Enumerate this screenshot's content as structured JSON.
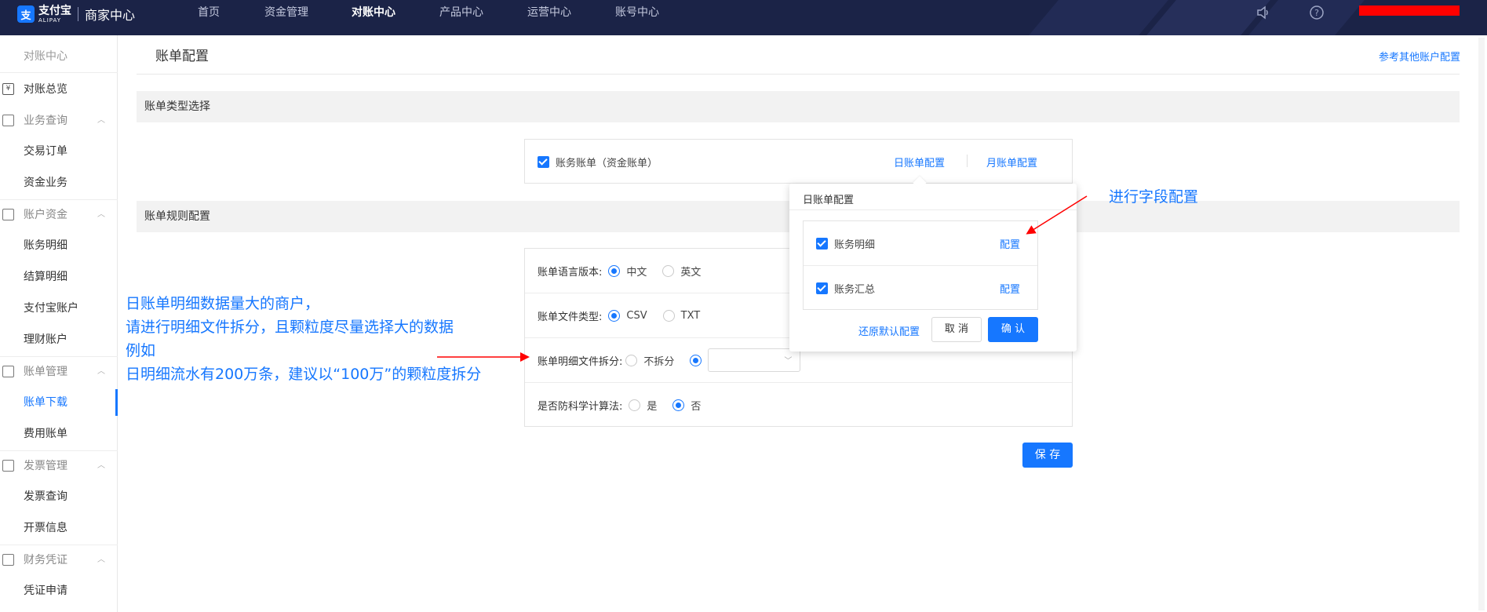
{
  "brand": {
    "logo_glyph": "支",
    "logo_cn": "支付宝",
    "logo_en": "ALIPAY",
    "title": "商家中心"
  },
  "topnav": [
    {
      "label": "首页",
      "active": false
    },
    {
      "label": "资金管理",
      "active": false
    },
    {
      "label": "对账中心",
      "active": true
    },
    {
      "label": "产品中心",
      "active": false
    },
    {
      "label": "运营中心",
      "active": false
    },
    {
      "label": "账号中心",
      "active": false
    }
  ],
  "top_icons": [
    "speaker-icon",
    "help-icon"
  ],
  "sidebar": {
    "title": "对账中心",
    "overview": "对账总览",
    "groups": [
      {
        "label": "业务查询",
        "items": [
          "交易订单",
          "资金业务"
        ]
      },
      {
        "label": "账户资金",
        "items": [
          "账务明细",
          "结算明细",
          "支付宝账户",
          "理财账户"
        ]
      },
      {
        "label": "账单管理",
        "items": [
          "账单下载",
          "费用账单"
        ]
      },
      {
        "label": "发票管理",
        "items": [
          "发票查询",
          "开票信息"
        ]
      },
      {
        "label": "财务凭证",
        "items": [
          "凭证申请"
        ]
      }
    ],
    "active_item": "账单下载"
  },
  "main": {
    "page_title": "账单配置",
    "ref_link": "参考其他账户配置",
    "section1": "账单类型选择",
    "section2": "账单规则配置",
    "bill_type": {
      "label": "账务账单（资金账单）",
      "daily_link": "日账单配置",
      "monthly_link": "月账单配置"
    },
    "rules": {
      "language": {
        "label": "账单语言版本:",
        "options": [
          "中文",
          "英文"
        ],
        "selected": "中文"
      },
      "filetype": {
        "label": "账单文件类型:",
        "options": [
          "CSV",
          "TXT"
        ],
        "selected": "CSV"
      },
      "split": {
        "label": "账单明细文件拆分:",
        "options": [
          "不拆分",
          ""
        ],
        "selected": ""
      },
      "anti_science": {
        "label": "是否防科学计算法:",
        "options": [
          "是",
          "否"
        ],
        "selected": "否"
      }
    },
    "save_label": "保 存"
  },
  "popover": {
    "title": "日账单配置",
    "items": [
      {
        "label": "账务明细",
        "action": "配置"
      },
      {
        "label": "账务汇总",
        "action": "配置"
      }
    ],
    "restore": "还原默认配置",
    "cancel": "取 消",
    "confirm": "确 认"
  },
  "annotations": {
    "right": "进行字段配置",
    "left": [
      "日账单明细数据量大的商户，",
      "请进行明细文件拆分，且颗粒度尽量选择大的数据",
      "例如",
      "日明细流水有200万条，建议以“100万”的颗粒度拆分"
    ]
  },
  "colors": {
    "topbar": "#1b2347",
    "accent": "#1677ff",
    "annotation_arrow": "#ff0000"
  }
}
